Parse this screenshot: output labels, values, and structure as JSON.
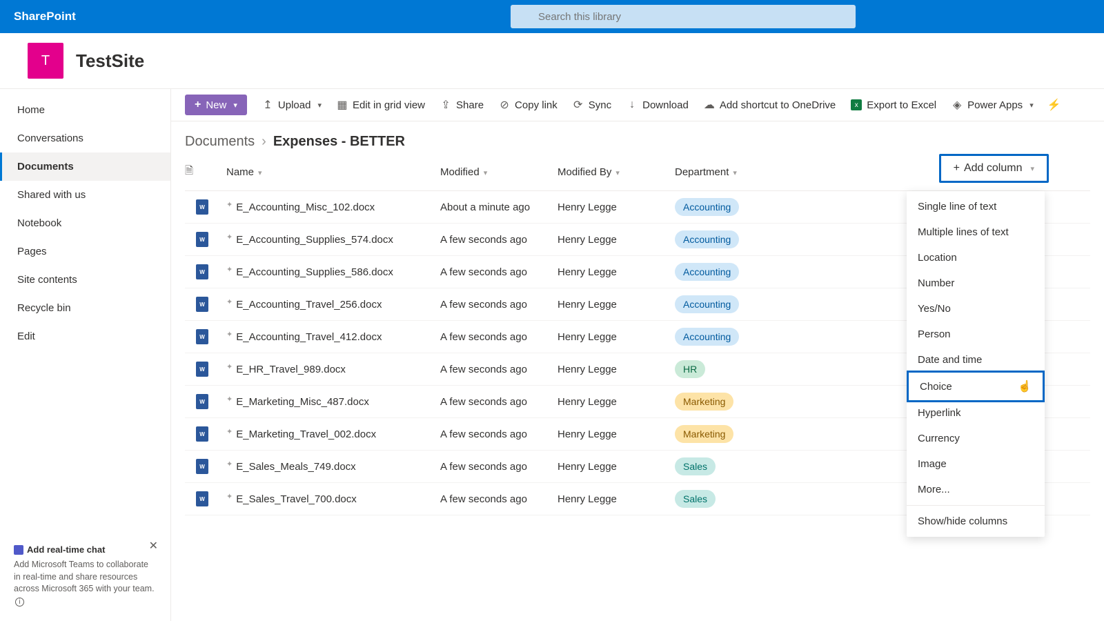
{
  "brand": "SharePoint",
  "search": {
    "placeholder": "Search this library"
  },
  "site": {
    "logoLetter": "T",
    "title": "TestSite"
  },
  "nav": {
    "items": [
      {
        "label": "Home"
      },
      {
        "label": "Conversations"
      },
      {
        "label": "Documents"
      },
      {
        "label": "Shared with us"
      },
      {
        "label": "Notebook"
      },
      {
        "label": "Pages"
      },
      {
        "label": "Site contents"
      },
      {
        "label": "Recycle bin"
      },
      {
        "label": "Edit"
      }
    ],
    "activeIndex": 2
  },
  "chatPromo": {
    "title": "Add real-time chat",
    "body": "Add Microsoft Teams to collaborate in real-time and share resources across Microsoft 365 with your team."
  },
  "toolbar": {
    "new": "New",
    "upload": "Upload",
    "editGrid": "Edit in grid view",
    "share": "Share",
    "copyLink": "Copy link",
    "sync": "Sync",
    "download": "Download",
    "shortcut": "Add shortcut to OneDrive",
    "exportExcel": "Export to Excel",
    "powerApps": "Power Apps"
  },
  "breadcrumb": {
    "parent": "Documents",
    "current": "Expenses - BETTER"
  },
  "columns": {
    "name": "Name",
    "modified": "Modified",
    "modifiedBy": "Modified By",
    "department": "Department",
    "addColumn": "Add column"
  },
  "rows": [
    {
      "name": "E_Accounting_Misc_102.docx",
      "modified": "About a minute ago",
      "modifiedBy": "Henry Legge",
      "department": "Accounting"
    },
    {
      "name": "E_Accounting_Supplies_574.docx",
      "modified": "A few seconds ago",
      "modifiedBy": "Henry Legge",
      "department": "Accounting"
    },
    {
      "name": "E_Accounting_Supplies_586.docx",
      "modified": "A few seconds ago",
      "modifiedBy": "Henry Legge",
      "department": "Accounting"
    },
    {
      "name": "E_Accounting_Travel_256.docx",
      "modified": "A few seconds ago",
      "modifiedBy": "Henry Legge",
      "department": "Accounting"
    },
    {
      "name": "E_Accounting_Travel_412.docx",
      "modified": "A few seconds ago",
      "modifiedBy": "Henry Legge",
      "department": "Accounting"
    },
    {
      "name": "E_HR_Travel_989.docx",
      "modified": "A few seconds ago",
      "modifiedBy": "Henry Legge",
      "department": "HR"
    },
    {
      "name": "E_Marketing_Misc_487.docx",
      "modified": "A few seconds ago",
      "modifiedBy": "Henry Legge",
      "department": "Marketing"
    },
    {
      "name": "E_Marketing_Travel_002.docx",
      "modified": "A few seconds ago",
      "modifiedBy": "Henry Legge",
      "department": "Marketing"
    },
    {
      "name": "E_Sales_Meals_749.docx",
      "modified": "A few seconds ago",
      "modifiedBy": "Henry Legge",
      "department": "Sales"
    },
    {
      "name": "E_Sales_Travel_700.docx",
      "modified": "A few seconds ago",
      "modifiedBy": "Henry Legge",
      "department": "Sales"
    }
  ],
  "columnTypeMenu": {
    "items": [
      "Single line of text",
      "Multiple lines of text",
      "Location",
      "Number",
      "Yes/No",
      "Person",
      "Date and time",
      "Choice",
      "Hyperlink",
      "Currency",
      "Image",
      "More..."
    ],
    "footer": "Show/hide columns",
    "highlightedIndex": 7
  }
}
